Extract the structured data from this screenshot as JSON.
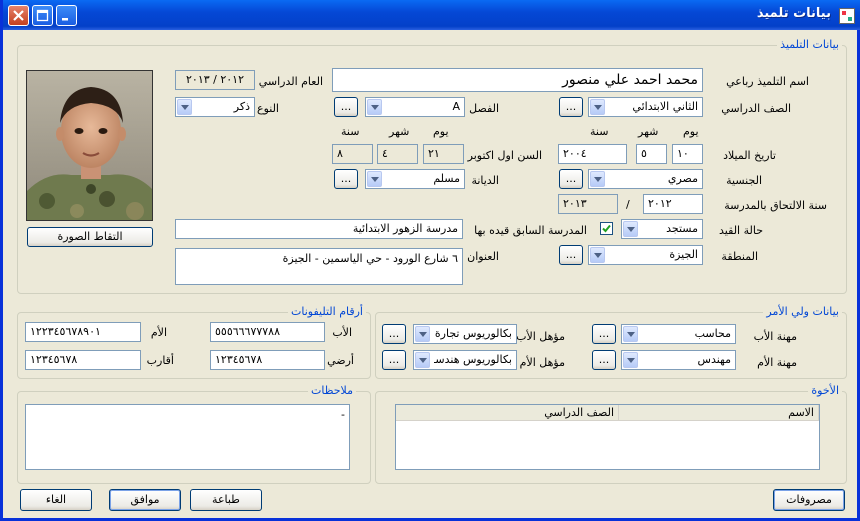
{
  "window": {
    "title": "بيانات تلميذ",
    "close_icon": "close-icon",
    "max_icon": "maximize-icon",
    "min_icon": "minimize-icon"
  },
  "student": {
    "legend": "بيانات التلميذ",
    "name_label": "اسم التلميذ رباعي",
    "name_value": "محمد احمد علي منصور",
    "year_label": "العام الدراسي",
    "year_value": "٢٠١٢ / ٢٠١٣",
    "grade_label": "الصف الدراسي",
    "grade_value": "الثاني الابتدائي",
    "class_label": "الفصل",
    "class_value": "A",
    "gender_label": "النوع",
    "gender_value": "ذكر",
    "day_hdr": "يوم",
    "month_hdr": "شهر",
    "year_hdr": "سنة",
    "dob_label": "تاريخ الميلاد",
    "dob_day": "١٠",
    "dob_month": "٥",
    "dob_year": "٢٠٠٤",
    "age_label": "السن اول اكتوبر",
    "age_day": "٢١",
    "age_month": "٤",
    "age_year": "٨",
    "nationality_label": "الجنسية",
    "nationality_value": "مصري",
    "religion_label": "الديانة",
    "religion_value": "مسلم",
    "enroll_label": "سنة الالتحاق بالمدرسة",
    "enroll_from": "٢٠١٢",
    "enroll_sep": "/",
    "enroll_to": "٢٠١٣",
    "status_label": "حالة القيد",
    "status_value": "مستجد",
    "prev_school_label": "المدرسة السابق قيده بها",
    "prev_school_checked": true,
    "prev_school_value": "مدرسة الزهور الابتدائية",
    "region_label": "المنطقة",
    "region_value": "الجيزة",
    "address_label": "العنوان",
    "address_value": "٦ شارع الورود - حي الياسمين - الجيزة",
    "ellipsis": "...",
    "capture_photo": "التقاط الصورة"
  },
  "guardian": {
    "legend": "بيانات ولي الأمر",
    "father_job_label": "مهنة الأب",
    "father_job_value": "محاسب",
    "father_qual_label": "مؤهل الأب",
    "father_qual_value": "بكالوريوس تجارة",
    "mother_job_label": "مهنة الأم",
    "mother_job_value": "مهندس",
    "mother_qual_label": "مؤهل الأم",
    "mother_qual_value": "بكالوريوس هندسـ...",
    "ellipsis": "..."
  },
  "phones": {
    "legend": "أرقام التليفونات",
    "father_label": "الأب",
    "father_value": "٥٥٥٦٦٦٧٧٧٨٨",
    "mother_label": "الأم",
    "mother_value": "١٢٢٣٤٥٦٧٨٩٠١",
    "landline_label": "أرضي",
    "landline_value": "١٢٣٤٥٦٧٨",
    "relatives_label": "أقارب",
    "relatives_value": "١٢٣٤٥٦٧٨"
  },
  "siblings": {
    "legend": "الأخوة",
    "col_name": "الاسم",
    "col_grade": "الصف الدراسي"
  },
  "notes": {
    "legend": "ملاحظات",
    "value": "-"
  },
  "buttons": {
    "expenses": "مصروفات",
    "ok": "موافق",
    "print": "طباعة",
    "cancel": "الغاء"
  }
}
